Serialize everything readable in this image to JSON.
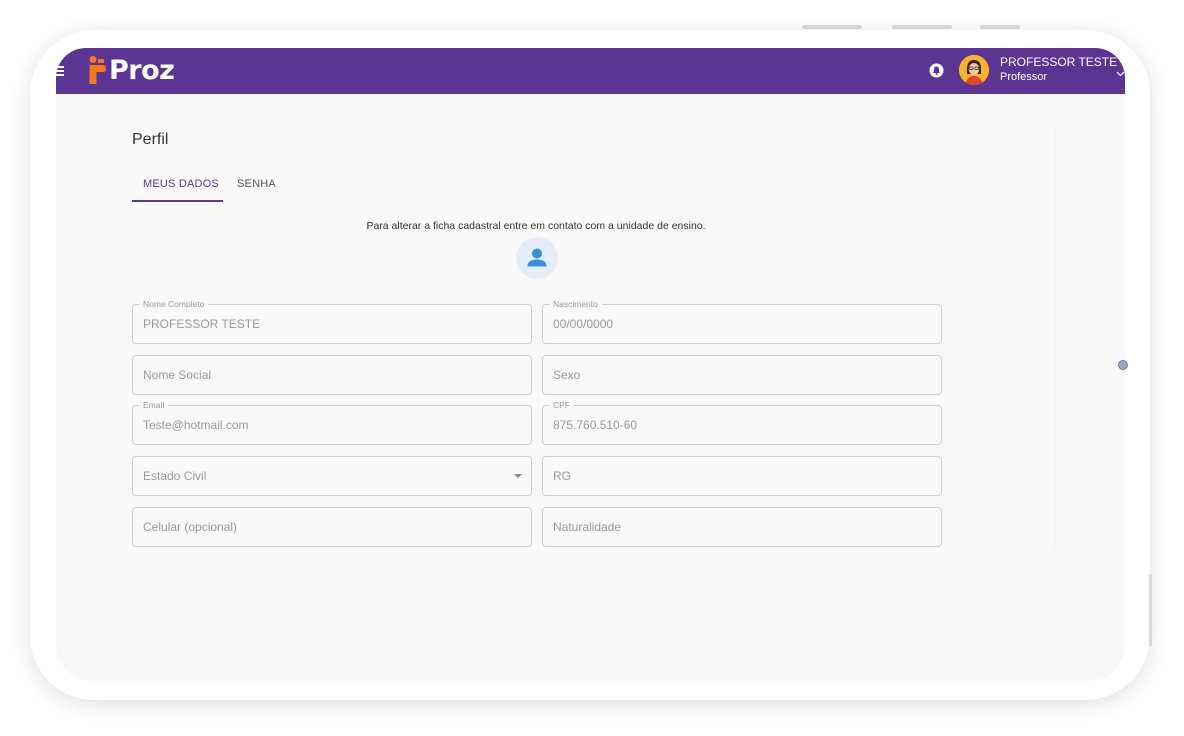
{
  "app": {
    "brand": "Proz",
    "colors": {
      "primary": "#5b3591",
      "accent": "#f27b1e",
      "avatar_bg": "#f7b32b"
    }
  },
  "header": {
    "user_name": "PROFESSOR TESTE",
    "user_role": "Professor",
    "icons": [
      "menu-icon",
      "bell-icon",
      "avatar",
      "chevron-down-icon"
    ]
  },
  "page": {
    "title": "Perfil",
    "tabs": [
      {
        "label": "MEUS DADOS",
        "active": true
      },
      {
        "label": "SENHA",
        "active": false
      }
    ],
    "notice": "Para alterar a ficha cadastral entre em contato com a unidade de ensino.",
    "photo_icon": "user-icon"
  },
  "form": {
    "nome_completo": {
      "label": "Nome Completo",
      "value": "PROFESSOR TESTE"
    },
    "nascimento": {
      "label": "Nascimento",
      "value": "00/00/0000"
    },
    "nome_social": {
      "placeholder": "Nome Social"
    },
    "sexo": {
      "placeholder": "Sexo"
    },
    "email": {
      "label": "Email",
      "value": "Teste@hotmail.com"
    },
    "cpf": {
      "label": "CPF",
      "value": "875.760.510-60"
    },
    "estado_civil": {
      "placeholder": "Estado Civil"
    },
    "rg": {
      "placeholder": "RG"
    },
    "celular": {
      "placeholder": "Celular (opcional)"
    },
    "naturalidade": {
      "placeholder": "Naturalidade"
    }
  }
}
